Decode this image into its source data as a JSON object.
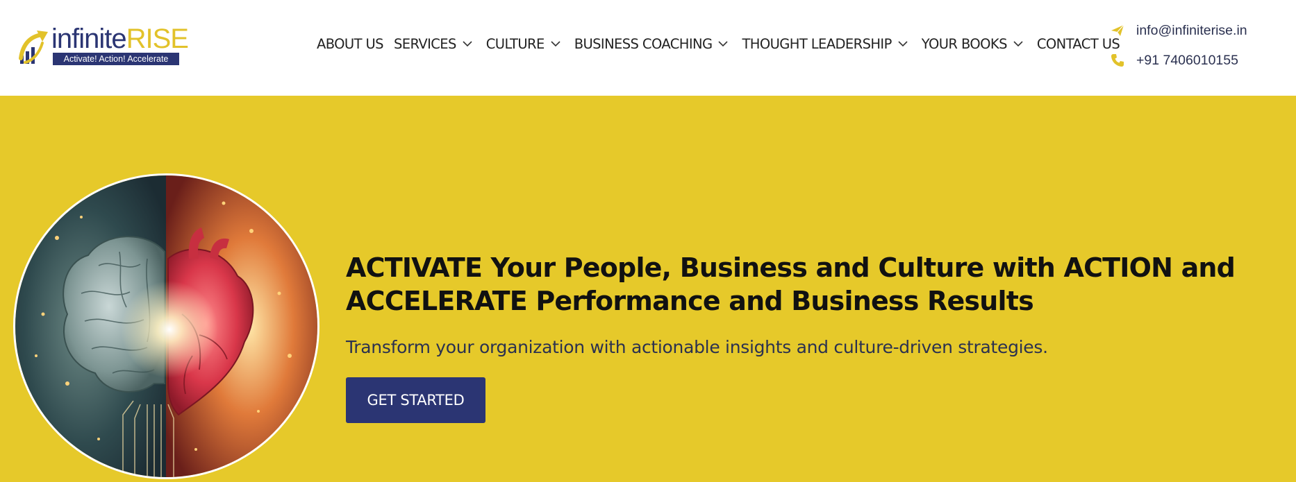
{
  "brand": {
    "name_part1": "infinite",
    "name_part2": "RISE",
    "tagline": "Activate! Action! Accelerate",
    "colors": {
      "navy": "#2b3573",
      "gold": "#e2c22a"
    }
  },
  "nav": {
    "items": [
      {
        "label": "ABOUT US",
        "has_dropdown": false
      },
      {
        "label": "SERVICES",
        "has_dropdown": true,
        "icon": "chevron-down-icon"
      },
      {
        "label": "CULTURE",
        "has_dropdown": true,
        "icon": "chevron-down-icon"
      },
      {
        "label": "BUSINESS COACHING",
        "has_dropdown": true,
        "icon": "chevron-down-icon"
      },
      {
        "label": "THOUGHT LEADERSHIP",
        "has_dropdown": true,
        "icon": "chevron-down-icon"
      },
      {
        "label": "YOUR BOOKS",
        "has_dropdown": true,
        "icon": "chevron-down-icon"
      },
      {
        "label": "CONTACT US",
        "has_dropdown": false
      }
    ]
  },
  "contact": {
    "email": {
      "icon": "paper-plane-icon",
      "text": "info@infiniterise.in"
    },
    "phone": {
      "icon": "phone-icon",
      "text": "+91 7406010155"
    },
    "icon_color": "#e2c22a"
  },
  "hero": {
    "background": "#e6c92a",
    "image": "brain-and-heart-illustration",
    "title_line1": "ACTIVATE Your People, Business and Culture with ACTION and",
    "title_line2": "ACCELERATE Performance and Business Results",
    "subtitle": "Transform your organization with actionable insights and culture-driven strategies.",
    "cta_label": "GET STARTED"
  }
}
